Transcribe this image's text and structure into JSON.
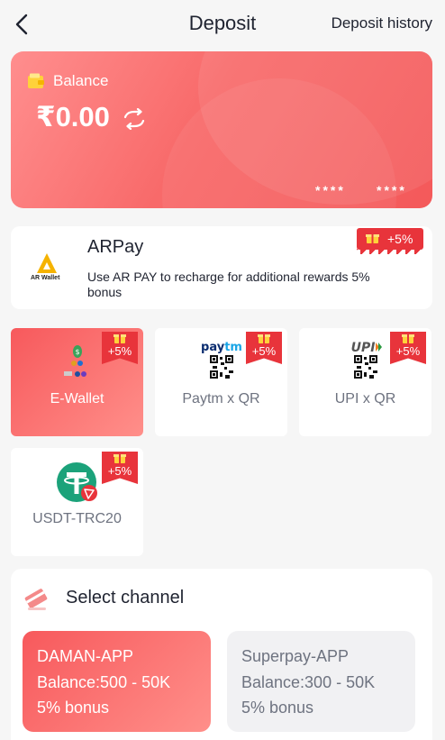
{
  "header": {
    "title": "Deposit",
    "history_label": "Deposit history"
  },
  "balance": {
    "label": "Balance",
    "amount": "₹0.00",
    "card_mask_left": "****",
    "card_mask_right": "****"
  },
  "arpay": {
    "title": "ARPay",
    "logo_text": "AR Wallet",
    "description": "Use AR PAY to recharge for additional rewards 5% bonus",
    "bonus": "+5%"
  },
  "methods": [
    {
      "label": "E-Wallet",
      "bonus": "+5%",
      "active": true,
      "icon": "e-wallet-icon"
    },
    {
      "label": "Paytm x QR",
      "bonus": "+5%",
      "active": false,
      "icon": "paytm-qr-icon"
    },
    {
      "label": "UPI x QR",
      "bonus": "+5%",
      "active": false,
      "icon": "upi-qr-icon"
    },
    {
      "label": "USDT-TRC20",
      "bonus": "+5%",
      "active": false,
      "icon": "tether-trc20-icon"
    }
  ],
  "channel": {
    "title": "Select channel",
    "options": [
      {
        "name": "DAMAN-APP",
        "range": "Balance:500 - 50K",
        "bonus": "5% bonus",
        "active": true
      },
      {
        "name": "Superpay-APP",
        "range": "Balance:300 - 50K",
        "bonus": "5% bonus",
        "active": false
      }
    ]
  },
  "colors": {
    "accent": "#f7595c",
    "badge": "#e8343b",
    "background": "#f6f6f6"
  }
}
